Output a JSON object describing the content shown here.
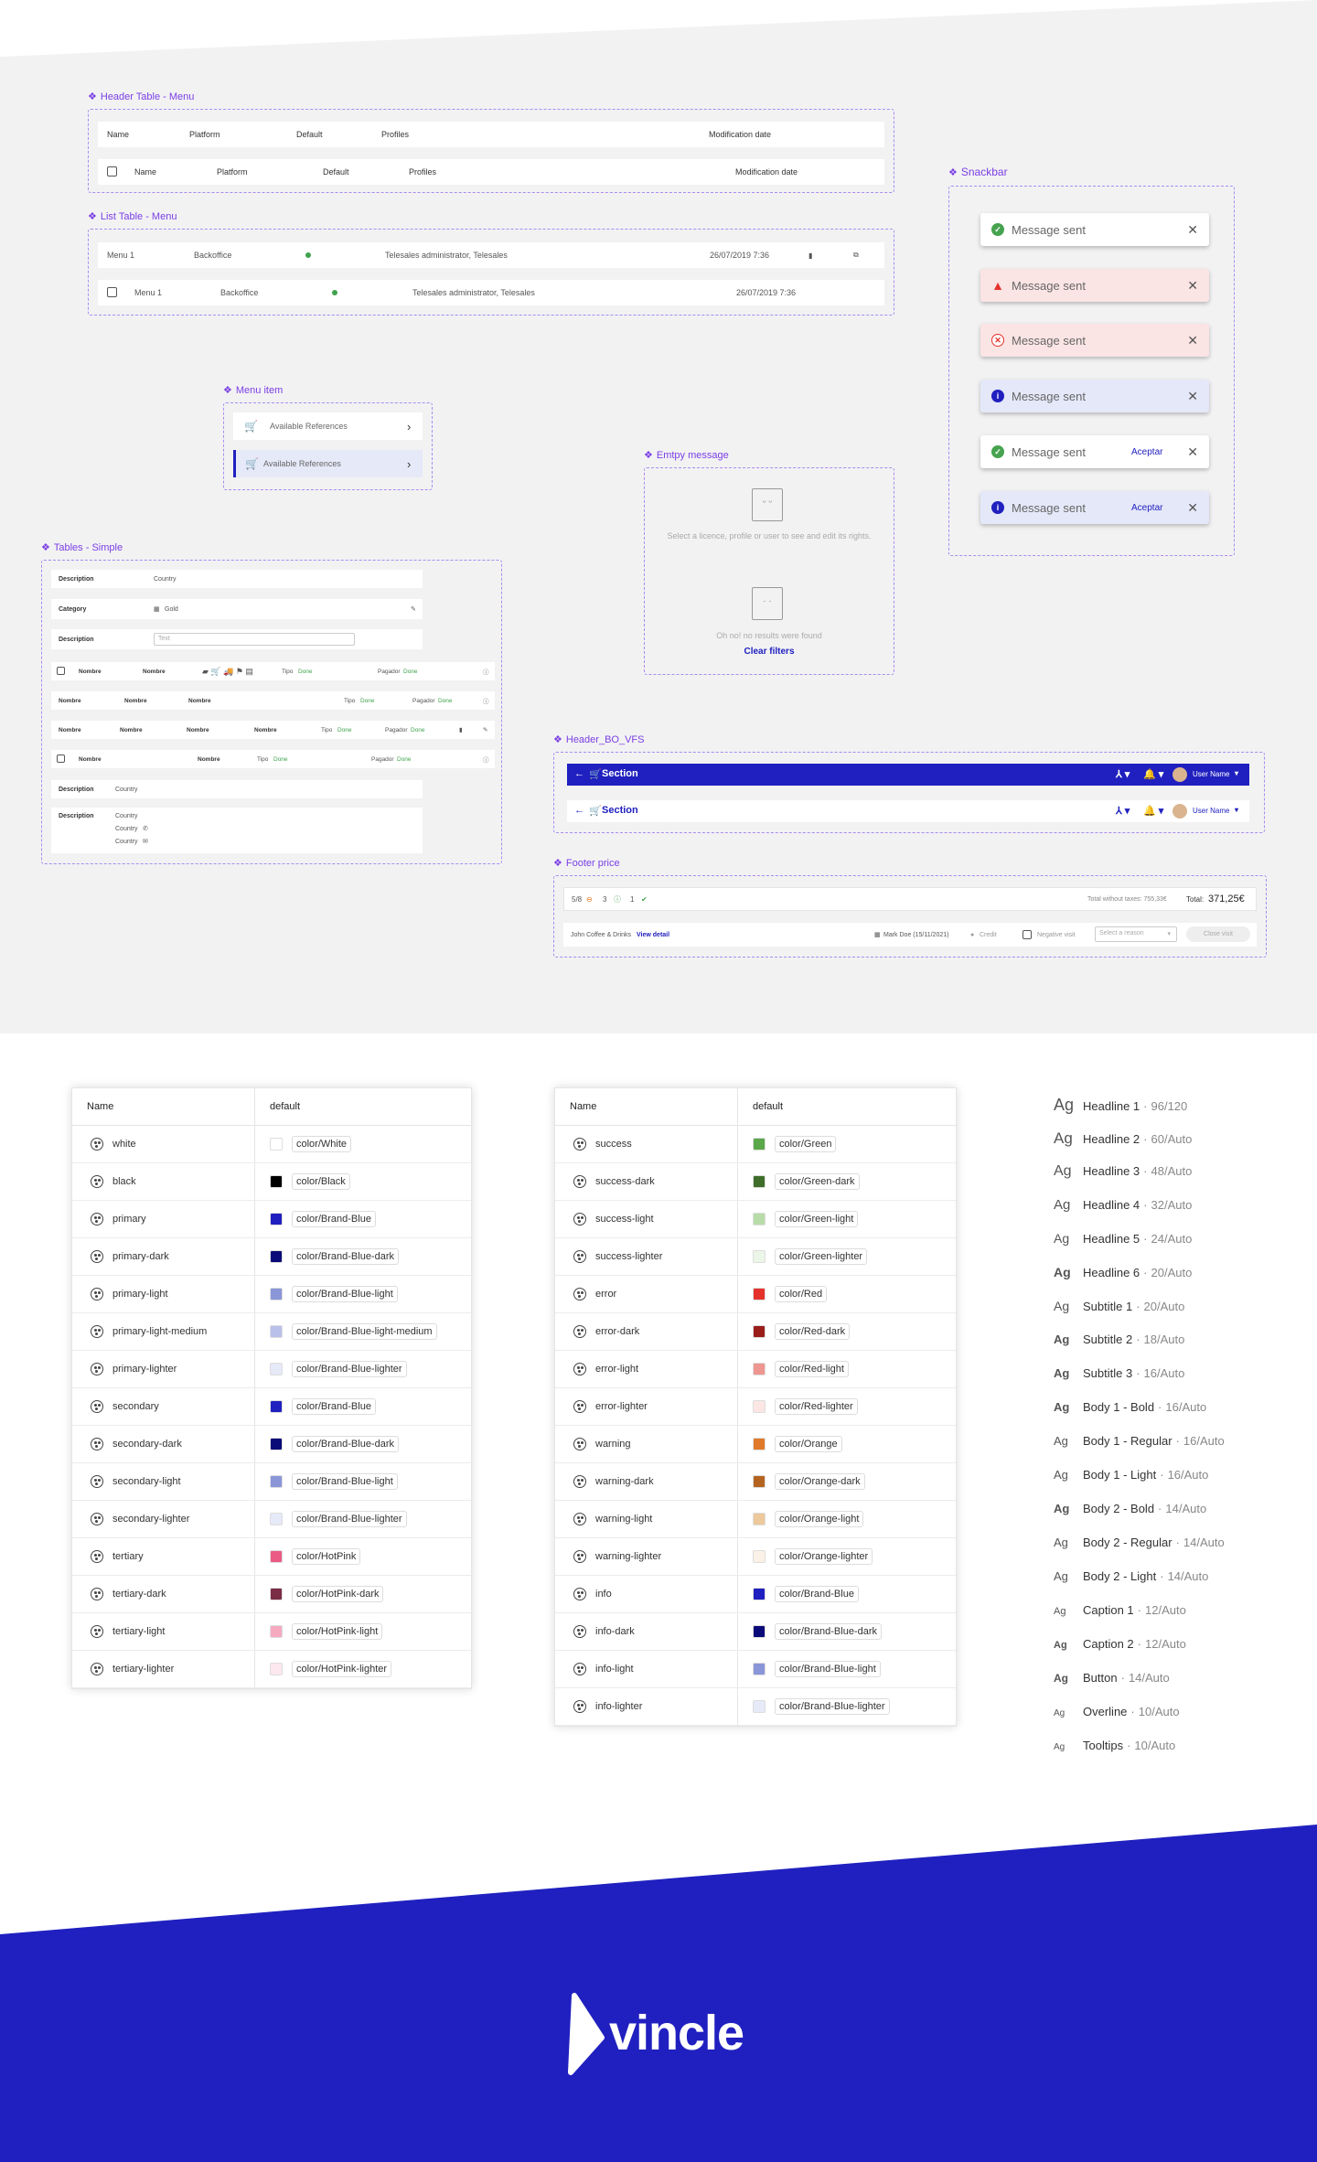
{
  "header_table": {
    "title": "Header Table - Menu",
    "cols": [
      "Name",
      "Platform",
      "Default",
      "Profiles",
      "Modification date"
    ]
  },
  "list_table": {
    "title": "List Table - Menu",
    "row": {
      "name": "Menu 1",
      "platform": "Backoffice",
      "profiles": "Telesales administrator, Telesales",
      "date": "26/07/2019 7:36"
    }
  },
  "menu_item": {
    "title": "Menu item",
    "label": "Available References"
  },
  "tables_simple": {
    "title": "Tables - Simple",
    "description": "Description",
    "country": "Country",
    "category": "Category",
    "gold": "Gold",
    "text_placeholder": "Text",
    "nombre": "Nombre",
    "tipo": "Tipo",
    "pagador": "Pagador",
    "done": "Done"
  },
  "empty_message": {
    "title": "Emtpy message",
    "text1": "Select a licence, profile or user to see and edit its rights.",
    "text2": "Oh no! no results were found",
    "link": "Clear filters"
  },
  "snackbar": {
    "title": "Snackbar",
    "message": "Message sent",
    "action": "Aceptar",
    "colors": {
      "success": "#46a34f",
      "error": "#e4312b",
      "info": "#2020c0",
      "error_bg": "#fbe4e4",
      "info_bg": "#e5e8f8"
    }
  },
  "header_bo": {
    "title": "Header_BO_VFS",
    "section": "Section",
    "user": "User Name"
  },
  "footer_price": {
    "title": "Footer price",
    "count1": "5/8",
    "count2": "3",
    "count3": "1",
    "total_wo_taxes": "Total without taxes: 755,33€",
    "total_label": "Total:",
    "total_value": "371,25€",
    "client": "John Coffee & Drinks",
    "view_detail": "View detail",
    "agent": "Mark Doe (15/11/2021)",
    "credit": "Credit",
    "negative_visit": "Negative visit",
    "select_reason": "Select a reason",
    "close_visit": "Close visit"
  },
  "colors_table_1": {
    "header": [
      "Name",
      "default"
    ],
    "rows": [
      {
        "name": "white",
        "token": "color/White",
        "hex": "#ffffff"
      },
      {
        "name": "black",
        "token": "color/Black",
        "hex": "#000000"
      },
      {
        "name": "primary",
        "token": "color/Brand-Blue",
        "hex": "#2020c0"
      },
      {
        "name": "primary-dark",
        "token": "color/Brand-Blue-dark",
        "hex": "#0a0a78"
      },
      {
        "name": "primary-light",
        "token": "color/Brand-Blue-light",
        "hex": "#8a96d8"
      },
      {
        "name": "primary-light-medium",
        "token": "color/Brand-Blue-light-medium",
        "hex": "#b9c0ea"
      },
      {
        "name": "primary-lighter",
        "token": "color/Brand-Blue-lighter",
        "hex": "#e6e9f8"
      },
      {
        "name": "secondary",
        "token": "color/Brand-Blue",
        "hex": "#2020c0"
      },
      {
        "name": "secondary-dark",
        "token": "color/Brand-Blue-dark",
        "hex": "#0a0a78"
      },
      {
        "name": "secondary-light",
        "token": "color/Brand-Blue-light",
        "hex": "#8a96d8"
      },
      {
        "name": "secondary-lighter",
        "token": "color/Brand-Blue-lighter",
        "hex": "#e6e9f8"
      },
      {
        "name": "tertiary",
        "token": "color/HotPink",
        "hex": "#ea5a84"
      },
      {
        "name": "tertiary-dark",
        "token": "color/HotPink-dark",
        "hex": "#7a2d45"
      },
      {
        "name": "tertiary-light",
        "token": "color/HotPink-light",
        "hex": "#f5aac0"
      },
      {
        "name": "tertiary-lighter",
        "token": "color/HotPink-lighter",
        "hex": "#fce8ee"
      }
    ]
  },
  "colors_table_2": {
    "header": [
      "Name",
      "default"
    ],
    "rows": [
      {
        "name": "success",
        "token": "color/Green",
        "hex": "#5aa84a"
      },
      {
        "name": "success-dark",
        "token": "color/Green-dark",
        "hex": "#3e6e2a"
      },
      {
        "name": "success-light",
        "token": "color/Green-light",
        "hex": "#b8dca8"
      },
      {
        "name": "success-lighter",
        "token": "color/Green-lighter",
        "hex": "#ecf6e8"
      },
      {
        "name": "error",
        "token": "color/Red",
        "hex": "#e4312b"
      },
      {
        "name": "error-dark",
        "token": "color/Red-dark",
        "hex": "#9a1d1a"
      },
      {
        "name": "error-light",
        "token": "color/Red-light",
        "hex": "#ee9690"
      },
      {
        "name": "error-lighter",
        "token": "color/Red-lighter",
        "hex": "#fce6e4"
      },
      {
        "name": "warning",
        "token": "color/Orange",
        "hex": "#e07a2a"
      },
      {
        "name": "warning-dark",
        "token": "color/Orange-dark",
        "hex": "#b56420"
      },
      {
        "name": "warning-light",
        "token": "color/Orange-light",
        "hex": "#edc89a"
      },
      {
        "name": "warning-lighter",
        "token": "color/Orange-lighter",
        "hex": "#fcf1e6"
      },
      {
        "name": "info",
        "token": "color/Brand-Blue",
        "hex": "#2020c0"
      },
      {
        "name": "info-dark",
        "token": "color/Brand-Blue-dark",
        "hex": "#0a0a78"
      },
      {
        "name": "info-light",
        "token": "color/Brand-Blue-light",
        "hex": "#8a96d8"
      },
      {
        "name": "info-lighter",
        "token": "color/Brand-Blue-lighter",
        "hex": "#e6e9f8"
      }
    ]
  },
  "typography": [
    {
      "ag": "Ag",
      "name": "Headline 1",
      "size": "96/120",
      "weight": "300"
    },
    {
      "ag": "Ag",
      "name": "Headline 2",
      "size": "60/Auto",
      "weight": "300"
    },
    {
      "ag": "Ag",
      "name": "Headline 3",
      "size": "48/Auto",
      "weight": "400"
    },
    {
      "ag": "Ag",
      "name": "Headline 4",
      "size": "32/Auto",
      "weight": "400"
    },
    {
      "ag": "Ag",
      "name": "Headline 5",
      "size": "24/Auto",
      "weight": "400"
    },
    {
      "ag": "Ag",
      "name": "Headline 6",
      "size": "20/Auto",
      "weight": "700"
    },
    {
      "ag": "Ag",
      "name": "Subtitle 1",
      "size": "20/Auto",
      "weight": "400"
    },
    {
      "ag": "Ag",
      "name": "Subtitle 2",
      "size": "18/Auto",
      "weight": "700"
    },
    {
      "ag": "Ag",
      "name": "Subtitle 3",
      "size": "16/Auto",
      "weight": "700"
    },
    {
      "ag": "Ag",
      "name": "Body 1 - Bold",
      "size": "16/Auto",
      "weight": "700"
    },
    {
      "ag": "Ag",
      "name": "Body 1 - Regular",
      "size": "16/Auto",
      "weight": "400"
    },
    {
      "ag": "Ag",
      "name": "Body 1 - Light",
      "size": "16/Auto",
      "weight": "300"
    },
    {
      "ag": "Ag",
      "name": "Body 2 - Bold",
      "size": "14/Auto",
      "weight": "700"
    },
    {
      "ag": "Ag",
      "name": "Body 2 - Regular",
      "size": "14/Auto",
      "weight": "400"
    },
    {
      "ag": "Ag",
      "name": "Body 2 - Light",
      "size": "14/Auto",
      "weight": "300"
    },
    {
      "ag": "Ag",
      "name": "Caption 1",
      "size": "12/Auto",
      "weight": "400"
    },
    {
      "ag": "Ag",
      "name": "Caption 2",
      "size": "12/Auto",
      "weight": "700"
    },
    {
      "ag": "Ag",
      "name": "Button",
      "size": "14/Auto",
      "weight": "700"
    },
    {
      "ag": "Ag",
      "name": "Overline",
      "size": "10/Auto",
      "weight": "400"
    },
    {
      "ag": "Ag",
      "name": "Tooltips",
      "size": "10/Auto",
      "weight": "400"
    }
  ],
  "brand": {
    "logo_text": "vincle",
    "band_color": "#2020c0"
  }
}
